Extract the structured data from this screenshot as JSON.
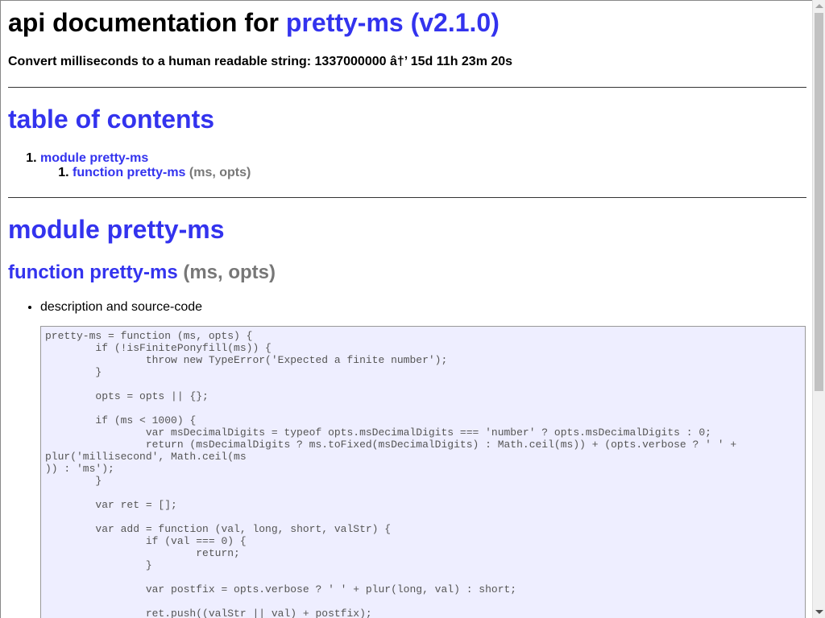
{
  "header": {
    "title_prefix": "api documentation for ",
    "title_link": "pretty-ms (v2.1.0)",
    "subtitle": "Convert milliseconds to a human readable string: 1337000000 â†’ 15d 11h 23m 20s"
  },
  "toc": {
    "heading": "table of contents",
    "items": [
      {
        "label": "module pretty-ms",
        "children": [
          {
            "label": "function pretty-ms",
            "signature": "(ms, opts)"
          }
        ]
      }
    ]
  },
  "module": {
    "heading": "module pretty-ms",
    "function": {
      "name": "function pretty-ms",
      "signature": "(ms, opts)",
      "bullet": "description and source-code",
      "code": "pretty-ms = function (ms, opts) {\n\tif (!isFinitePonyfill(ms)) {\n\t\tthrow new TypeError('Expected a finite number');\n\t}\n\n\topts = opts || {};\n\n\tif (ms < 1000) {\n\t\tvar msDecimalDigits = typeof opts.msDecimalDigits === 'number' ? opts.msDecimalDigits : 0;\n\t\treturn (msDecimalDigits ? ms.toFixed(msDecimalDigits) : Math.ceil(ms)) + (opts.verbose ? ' ' +\nplur('millisecond', Math.ceil(ms\n)) : 'ms');\n\t}\n\n\tvar ret = [];\n\n\tvar add = function (val, long, short, valStr) {\n\t\tif (val === 0) {\n\t\t\treturn;\n\t\t}\n\n\t\tvar postfix = opts.verbose ? ' ' + plur(long, val) : short;\n\n\t\tret.push((valStr || val) + postfix);"
    }
  },
  "colors": {
    "link": "#3333ee",
    "muted": "#777777",
    "code_background": "#eeeeff"
  }
}
